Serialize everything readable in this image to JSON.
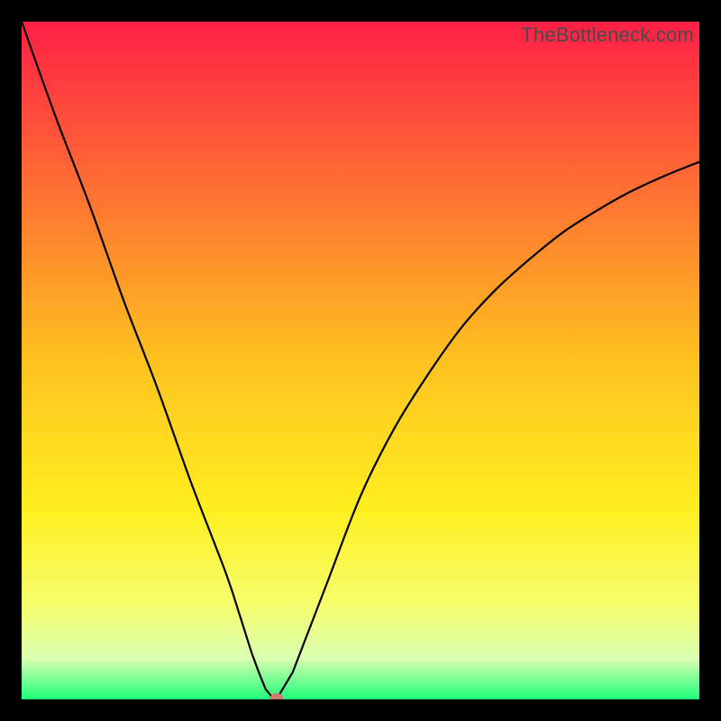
{
  "watermark": "TheBottleneck.com",
  "colors": {
    "top": "#ff1f46",
    "mid_upper": "#ff8b2e",
    "mid": "#ffde1f",
    "mid_lower": "#f6ff6d",
    "base_pale": "#d9ffb0",
    "bottom": "#1eff7a",
    "frame": "#000000",
    "curve": "#000000",
    "marker": "#cf7a70"
  },
  "chart_data": {
    "type": "line",
    "title": "",
    "xlabel": "",
    "ylabel": "",
    "xlim": [
      0,
      100
    ],
    "ylim": [
      0,
      100
    ],
    "x": [
      0,
      5,
      10,
      15,
      20,
      25,
      30,
      32,
      34,
      35,
      36,
      37,
      37.6,
      40,
      45,
      50,
      55,
      60,
      65,
      70,
      75,
      80,
      85,
      90,
      95,
      100
    ],
    "y": [
      100,
      86,
      73,
      59,
      46,
      32,
      19,
      13,
      6.7,
      4,
      1.5,
      0.3,
      0,
      4,
      17,
      30,
      40,
      48,
      55,
      60.5,
      65,
      69,
      72.2,
      75,
      77.3,
      79.3
    ],
    "minimum_point": {
      "x": 37.6,
      "y": 0
    },
    "gradient_stops": [
      {
        "pos": 0.0,
        "hex": "#ff1f46"
      },
      {
        "pos": 0.5,
        "hex": "#ffc21f"
      },
      {
        "pos": 0.72,
        "hex": "#ffef1f"
      },
      {
        "pos": 0.86,
        "hex": "#f6ff6d"
      },
      {
        "pos": 0.94,
        "hex": "#d9ffb0"
      },
      {
        "pos": 1.0,
        "hex": "#1eff7a"
      }
    ]
  }
}
